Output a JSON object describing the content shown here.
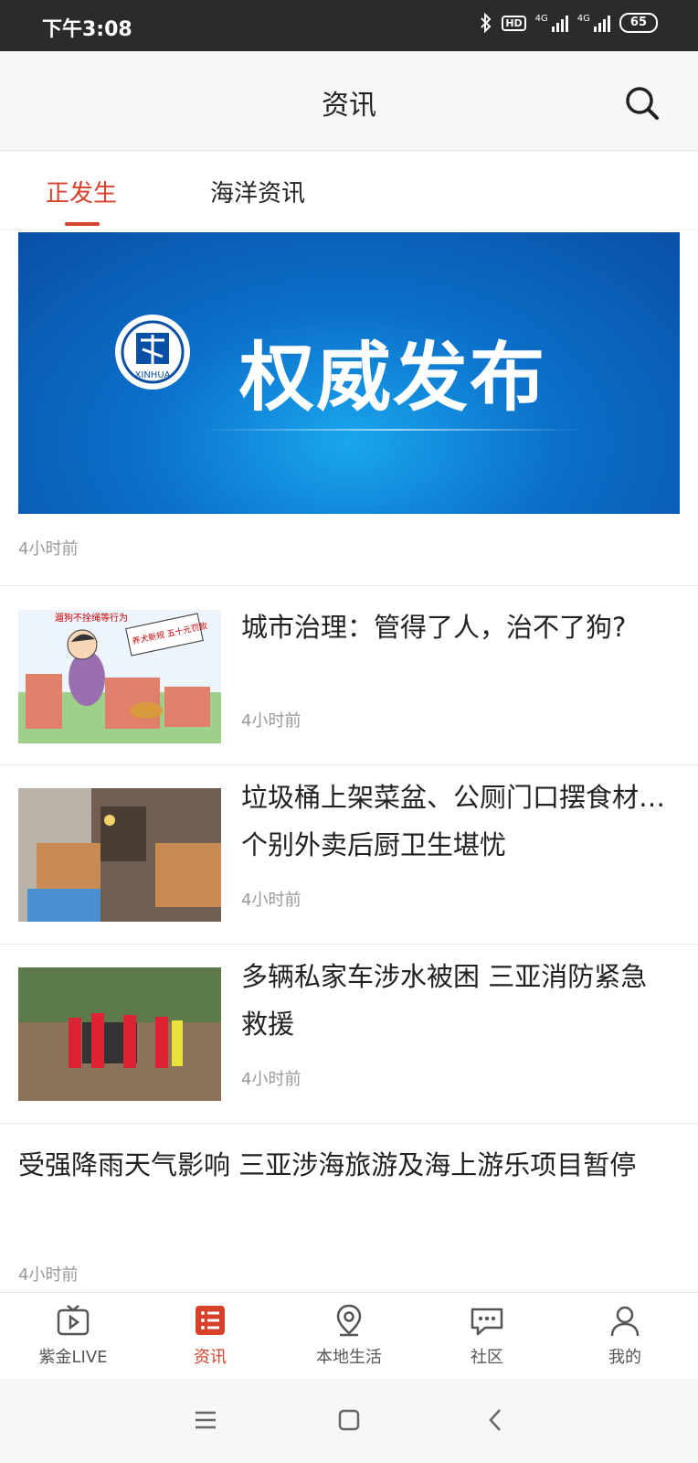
{
  "status": {
    "time": "下午3:08",
    "hd": "HD",
    "net1": "4G",
    "net2": "4G",
    "battery": "65"
  },
  "header": {
    "title": "资讯",
    "search_icon": "search-icon"
  },
  "tabs": [
    {
      "label": "正发生",
      "active": true
    },
    {
      "label": "海洋资讯",
      "active": false
    }
  ],
  "banner": {
    "text": "权威发布",
    "logo_text": "XINHUA",
    "time": "4小时前"
  },
  "news": [
    {
      "title": "城市治理：管得了人，治不了狗?",
      "time": "4小时前",
      "thumb_caption": "遛狗不拴绳等行为",
      "thumb_sign": "养犬新规 五十元罚款"
    },
    {
      "title": "垃圾桶上架菜盆、公厕门口摆食材…个别外卖后厨卫生堪忧",
      "time": "4小时前"
    },
    {
      "title": "多辆私家车涉水被困 三亚消防紧急救援",
      "time": "4小时前"
    },
    {
      "title": "受强降雨天气影响 三亚涉海旅游及海上游乐项目暂停",
      "time": "4小时前"
    }
  ],
  "bottom_nav": [
    {
      "label": "紫金LIVE",
      "icon": "tv-play-icon",
      "active": false
    },
    {
      "label": "资讯",
      "icon": "news-list-icon",
      "active": true
    },
    {
      "label": "本地生活",
      "icon": "location-pin-icon",
      "active": false
    },
    {
      "label": "社区",
      "icon": "chat-bubble-icon",
      "active": false
    },
    {
      "label": "我的",
      "icon": "person-icon",
      "active": false
    }
  ],
  "colors": {
    "accent": "#d6412b",
    "status_bar": "#2b2b2b",
    "banner_blue": "#0b6fc9"
  }
}
